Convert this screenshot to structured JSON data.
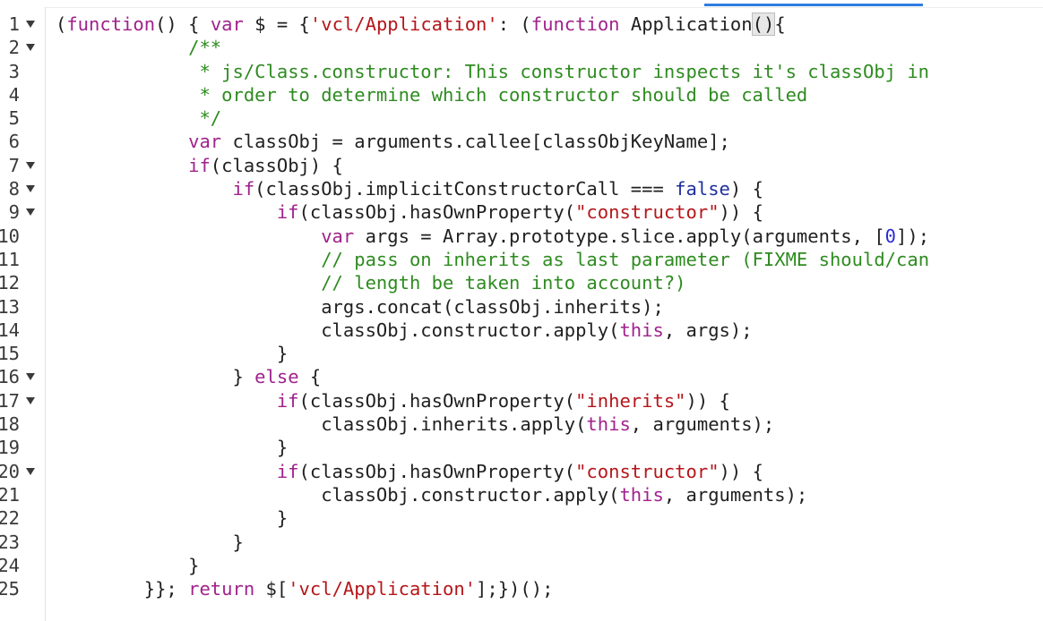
{
  "editor": {
    "lines": [
      {
        "n": "1",
        "fold": true,
        "tokens": [
          [
            "pl",
            "("
          ],
          [
            "kw",
            "function"
          ],
          [
            "pl",
            "() { "
          ],
          [
            "kw",
            "var"
          ],
          [
            "pl",
            " $ = {"
          ],
          [
            "str",
            "'vcl/Application'"
          ],
          [
            "pl",
            ": ("
          ],
          [
            "kw",
            "function"
          ],
          [
            "pl",
            " Application"
          ],
          [
            "cursor",
            ""
          ],
          [
            "hl",
            "()"
          ],
          [
            "pl",
            "{"
          ]
        ]
      },
      {
        "n": "2",
        "fold": true,
        "tokens": [
          [
            "pl",
            "            "
          ],
          [
            "com",
            "/**"
          ]
        ]
      },
      {
        "n": "3",
        "fold": false,
        "tokens": [
          [
            "pl",
            "            "
          ],
          [
            "com",
            " * js/Class.constructor: This constructor inspects it's classObj in"
          ]
        ]
      },
      {
        "n": "4",
        "fold": false,
        "tokens": [
          [
            "pl",
            "            "
          ],
          [
            "com",
            " * order to determine which constructor should be called"
          ]
        ]
      },
      {
        "n": "5",
        "fold": false,
        "tokens": [
          [
            "pl",
            "            "
          ],
          [
            "com",
            " */"
          ]
        ]
      },
      {
        "n": "6",
        "fold": false,
        "tokens": [
          [
            "pl",
            "            "
          ],
          [
            "kw",
            "var"
          ],
          [
            "pl",
            " classObj = arguments.callee[classObjKeyName];"
          ]
        ]
      },
      {
        "n": "7",
        "fold": true,
        "tokens": [
          [
            "pl",
            "            "
          ],
          [
            "kw",
            "if"
          ],
          [
            "pl",
            "(classObj) {"
          ]
        ]
      },
      {
        "n": "8",
        "fold": true,
        "tokens": [
          [
            "pl",
            "                "
          ],
          [
            "kw",
            "if"
          ],
          [
            "pl",
            "(classObj.implicitConstructorCall === "
          ],
          [
            "bool",
            "false"
          ],
          [
            "pl",
            ") {"
          ]
        ]
      },
      {
        "n": "9",
        "fold": true,
        "tokens": [
          [
            "pl",
            "                    "
          ],
          [
            "kw",
            "if"
          ],
          [
            "pl",
            "(classObj.hasOwnProperty("
          ],
          [
            "str",
            "\"constructor\""
          ],
          [
            "pl",
            ")) {"
          ]
        ]
      },
      {
        "n": "10",
        "fold": false,
        "tokens": [
          [
            "pl",
            "                        "
          ],
          [
            "kw",
            "var"
          ],
          [
            "pl",
            " args = Array.prototype.slice.apply(arguments, ["
          ],
          [
            "num",
            "0"
          ],
          [
            "pl",
            "]);"
          ]
        ]
      },
      {
        "n": "11",
        "fold": false,
        "tokens": [
          [
            "pl",
            "                        "
          ],
          [
            "com",
            "// pass on inherits as last parameter (FIXME should/can"
          ]
        ]
      },
      {
        "n": "12",
        "fold": false,
        "tokens": [
          [
            "pl",
            "                        "
          ],
          [
            "com",
            "// length be taken into account?)"
          ]
        ]
      },
      {
        "n": "13",
        "fold": false,
        "tokens": [
          [
            "pl",
            "                        args.concat(classObj.inherits);"
          ]
        ]
      },
      {
        "n": "14",
        "fold": false,
        "tokens": [
          [
            "pl",
            "                        classObj.constructor.apply("
          ],
          [
            "kw",
            "this"
          ],
          [
            "pl",
            ", args);"
          ]
        ]
      },
      {
        "n": "15",
        "fold": false,
        "tokens": [
          [
            "pl",
            "                    }"
          ]
        ]
      },
      {
        "n": "16",
        "fold": true,
        "tokens": [
          [
            "pl",
            "                } "
          ],
          [
            "kw",
            "else"
          ],
          [
            "pl",
            " {"
          ]
        ]
      },
      {
        "n": "17",
        "fold": true,
        "tokens": [
          [
            "pl",
            "                    "
          ],
          [
            "kw",
            "if"
          ],
          [
            "pl",
            "(classObj.hasOwnProperty("
          ],
          [
            "str",
            "\"inherits\""
          ],
          [
            "pl",
            ")) {"
          ]
        ]
      },
      {
        "n": "18",
        "fold": false,
        "tokens": [
          [
            "pl",
            "                        classObj.inherits.apply("
          ],
          [
            "kw",
            "this"
          ],
          [
            "pl",
            ", arguments);"
          ]
        ]
      },
      {
        "n": "19",
        "fold": false,
        "tokens": [
          [
            "pl",
            "                    }"
          ]
        ]
      },
      {
        "n": "20",
        "fold": true,
        "tokens": [
          [
            "pl",
            "                    "
          ],
          [
            "kw",
            "if"
          ],
          [
            "pl",
            "(classObj.hasOwnProperty("
          ],
          [
            "str",
            "\"constructor\""
          ],
          [
            "pl",
            ")) {"
          ]
        ]
      },
      {
        "n": "21",
        "fold": false,
        "tokens": [
          [
            "pl",
            "                        classObj.constructor.apply("
          ],
          [
            "kw",
            "this"
          ],
          [
            "pl",
            ", arguments);"
          ]
        ]
      },
      {
        "n": "22",
        "fold": false,
        "tokens": [
          [
            "pl",
            "                    }"
          ]
        ]
      },
      {
        "n": "23",
        "fold": false,
        "tokens": [
          [
            "pl",
            "                }"
          ]
        ]
      },
      {
        "n": "24",
        "fold": false,
        "tokens": [
          [
            "pl",
            "            }"
          ]
        ]
      },
      {
        "n": "25",
        "fold": false,
        "tokens": [
          [
            "pl",
            "        }}; "
          ],
          [
            "kw",
            "return"
          ],
          [
            "pl",
            " $["
          ],
          [
            "str",
            "'vcl/Application'"
          ],
          [
            "pl",
            "];})();"
          ]
        ]
      }
    ]
  },
  "colors": {
    "keyword": "#a0228c",
    "string": "#b5161a",
    "comment": "#2e8b20",
    "boolean": "#1e2f9e",
    "number": "#2b2bd6",
    "plain": "#1f1f1f",
    "scrollbar_thumb": "#2f7de1"
  },
  "icons": {
    "fold": "chevron-down-icon"
  }
}
